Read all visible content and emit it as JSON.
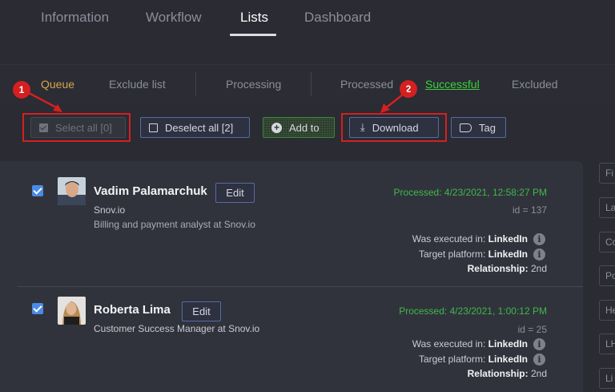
{
  "top_tabs": [
    {
      "label": "Information"
    },
    {
      "label": "Workflow"
    },
    {
      "label": "Lists"
    },
    {
      "label": "Dashboard"
    }
  ],
  "sub_tabs": [
    {
      "label": "Queue"
    },
    {
      "label": "Exclude list"
    },
    {
      "label": "Processing"
    },
    {
      "label": "Processed"
    },
    {
      "label": "Successful"
    },
    {
      "label": "Excluded"
    }
  ],
  "toolbar": {
    "select_all": "Select all [0]",
    "deselect_all": "Deselect all [2]",
    "add_to": "Add to",
    "download": "Download",
    "tag": "Tag"
  },
  "callouts": [
    "1",
    "2"
  ],
  "colors": {
    "accent": "#5a6aa3",
    "success": "#3eb84a",
    "callout": "#d42020",
    "queue": "#d4a64a"
  },
  "contacts": [
    {
      "name": "Vadim Palamarchuk",
      "edit": "Edit",
      "company": "Snov.io",
      "title": "Billing and payment analyst at Snov.io",
      "processed": "Processed: 4/23/2021, 12:58:27 PM",
      "id": "id = 137",
      "executed_label": "Was executed in:",
      "executed_value": "LinkedIn",
      "platform_label": "Target platform:",
      "platform_value": "LinkedIn",
      "relationship_label": "Relationship:",
      "relationship_value": "2nd"
    },
    {
      "name": "Roberta Lima",
      "edit": "Edit",
      "title": "Customer Success Manager at Snov.io",
      "processed": "Processed: 4/23/2021, 1:00:12 PM",
      "id": "id = 25",
      "executed_label": "Was executed in:",
      "executed_value": "LinkedIn",
      "platform_label": "Target platform:",
      "platform_value": "LinkedIn",
      "relationship_label": "Relationship:",
      "relationship_value": "2nd"
    }
  ],
  "right_filters": [
    "Fi",
    "La",
    "Co",
    "Po",
    "He",
    "LH",
    "Li"
  ]
}
